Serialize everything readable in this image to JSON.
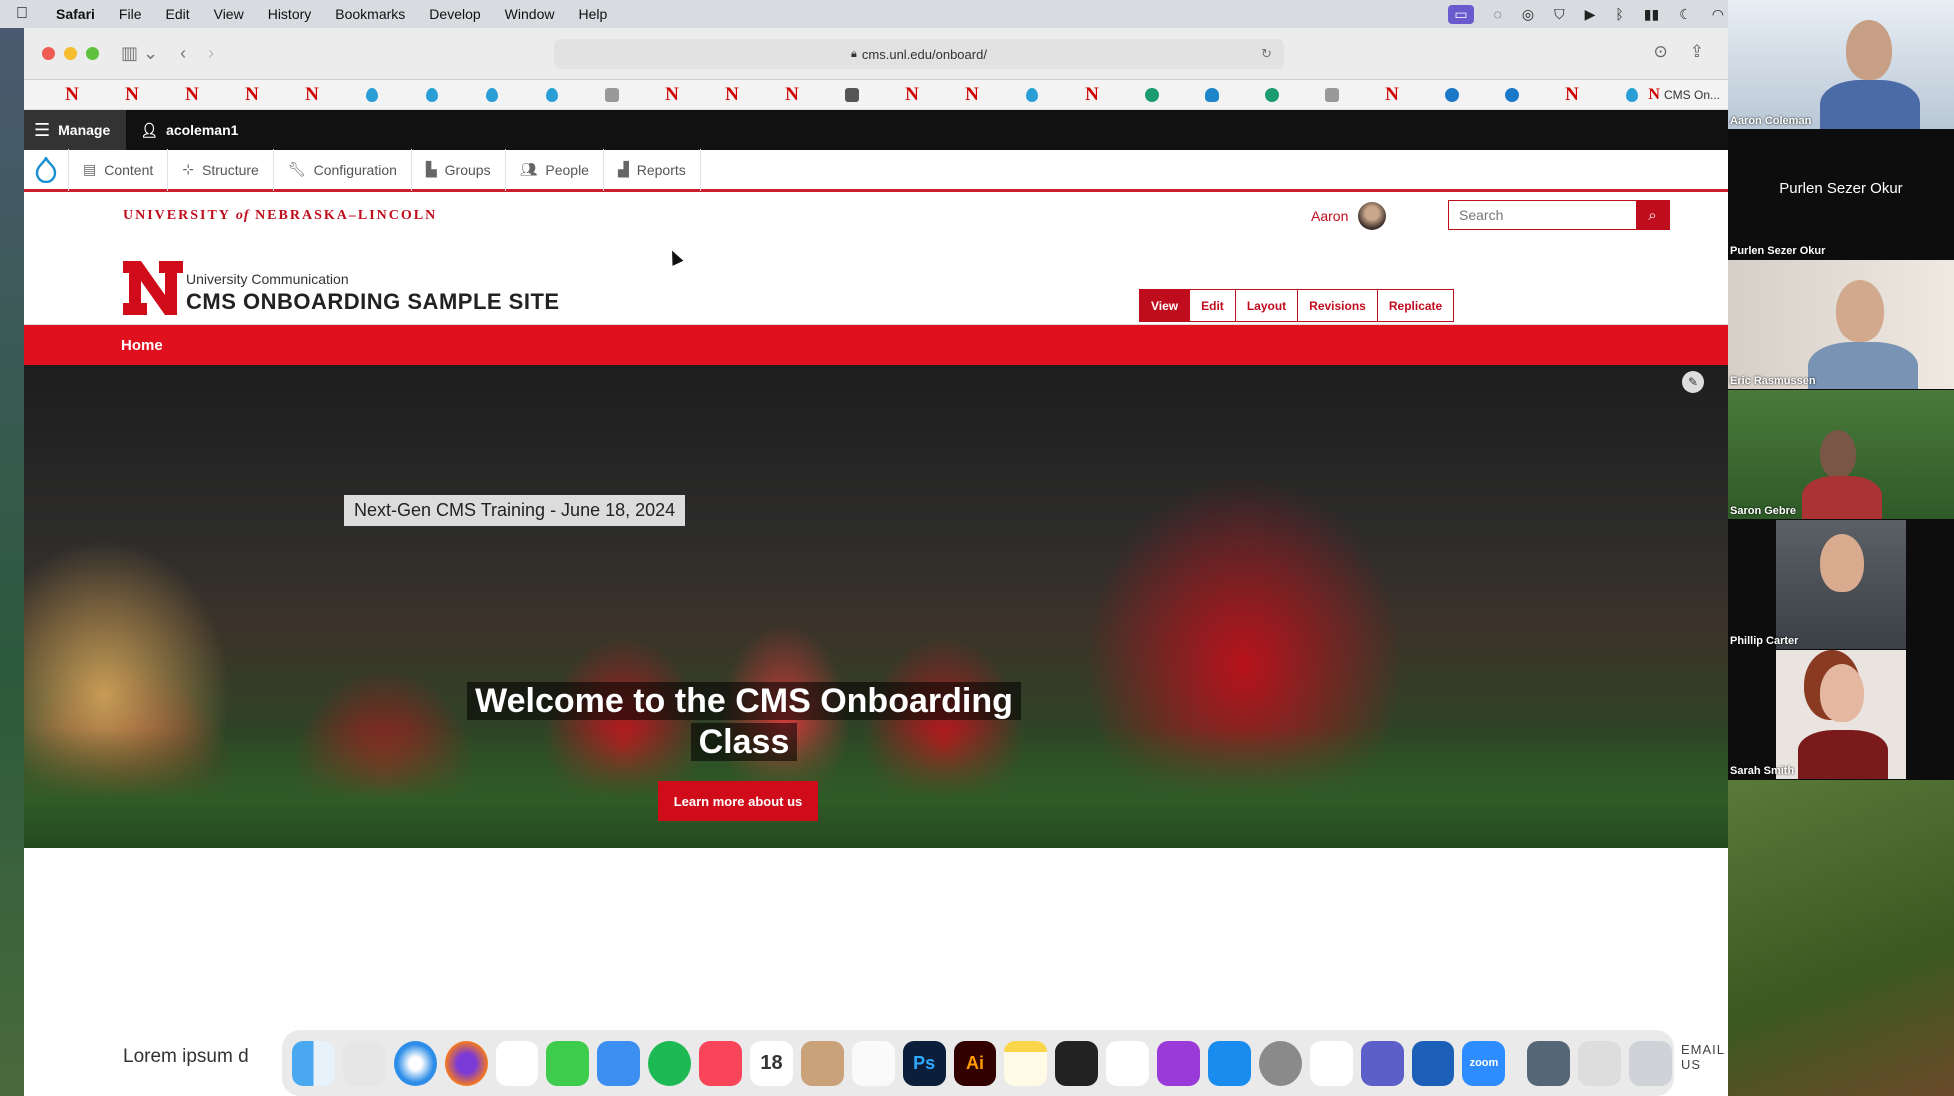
{
  "menubar": {
    "app": "Safari",
    "items": [
      "File",
      "Edit",
      "View",
      "History",
      "Bookmarks",
      "Develop",
      "Window",
      "Help"
    ]
  },
  "browser": {
    "url": "cms.unl.edu/onboard/",
    "bookmark_last": "CMS On..."
  },
  "admin": {
    "manage": "Manage",
    "user": "acoleman1",
    "menu": [
      "Content",
      "Structure",
      "Configuration",
      "Groups",
      "People",
      "Reports"
    ]
  },
  "site": {
    "university": {
      "pre": "UNIVERSITY",
      "of": "of",
      "post": "NEBRASKA–LINCOLN"
    },
    "account_name": "Aaron",
    "search_placeholder": "Search",
    "unit": "University Communication",
    "title": "CMS ONBOARDING SAMPLE SITE",
    "tabs": [
      "View",
      "Edit",
      "Layout",
      "Revisions",
      "Replicate"
    ],
    "nav_home": "Home"
  },
  "hero": {
    "caption": "Next-Gen CMS Training - June 18, 2024",
    "headline": "Welcome to the CMS Onboarding Class",
    "cta": "Learn more about us"
  },
  "lower": {
    "lorem": "Lorem ipsum d",
    "email": "EMAIL US"
  },
  "dock": {
    "calendar_day": "18",
    "ps": "Ps",
    "ai": "Ai",
    "zoom": "zoom"
  },
  "participants": [
    {
      "name": "Aaron Coleman"
    },
    {
      "name": "Purlen Sezer Okur",
      "center": "Purlen Sezer Okur"
    },
    {
      "name": "Eric Rasmussen"
    },
    {
      "name": "Saron Gebre"
    },
    {
      "name": "Phillip Carter"
    },
    {
      "name": "Sarah Smith"
    }
  ]
}
